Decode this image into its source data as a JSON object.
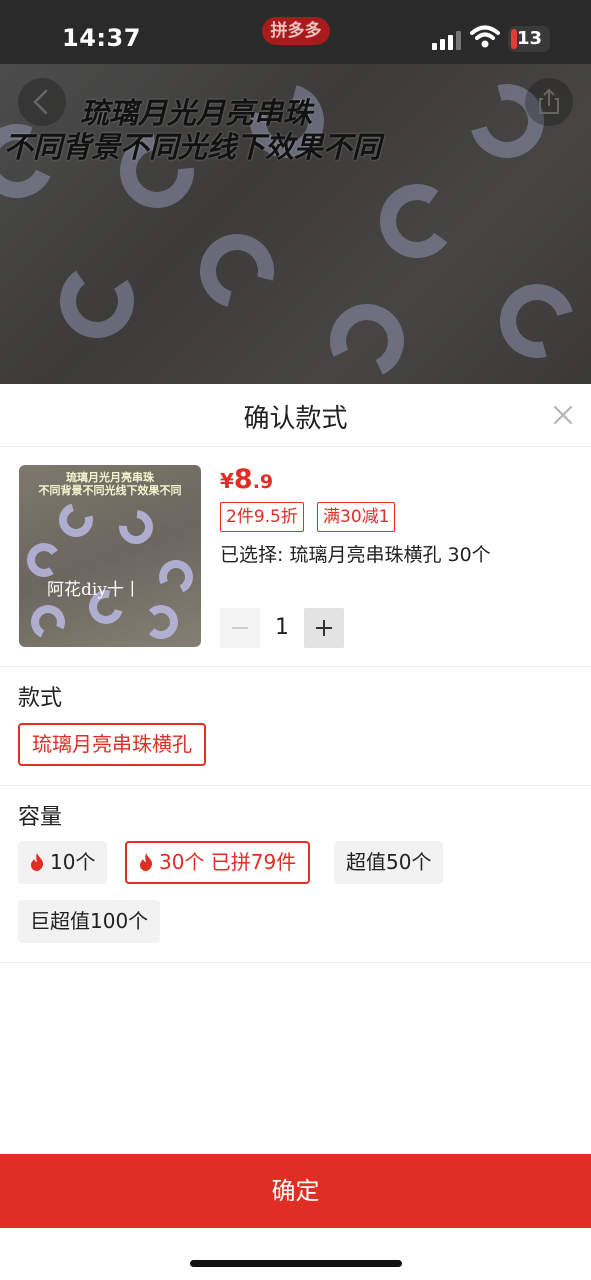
{
  "status_bar": {
    "time": "14:37",
    "app_badge": "拼多多",
    "battery": "13"
  },
  "hero": {
    "title_line1": "琉璃月光月亮串珠",
    "title_line2": "不同背景不同光线下效果不同"
  },
  "sheet": {
    "title": "确认款式"
  },
  "product": {
    "thumb_caption_1": "琉璃月光月亮串珠",
    "thumb_caption_2": "不同背景不同光线下效果不同",
    "thumb_watermark": "阿花diy十丨",
    "price_symbol": "¥",
    "price_int": "8",
    "price_dec": ".9",
    "tags": [
      "2件9.5折",
      "满30减1"
    ],
    "selected": "已选择: 琉璃月亮串珠横孔 30个",
    "quantity": "1"
  },
  "style_section": {
    "label": "款式",
    "options": [
      "琉璃月亮串珠横孔"
    ]
  },
  "capacity_section": {
    "label": "容量",
    "options": [
      "10个",
      "30个 已拼79件",
      "超值50个",
      "巨超值100个"
    ]
  },
  "confirm_button": "确定",
  "colors": {
    "accent": "#e02e24",
    "status_bg": "#2a2a2a"
  }
}
